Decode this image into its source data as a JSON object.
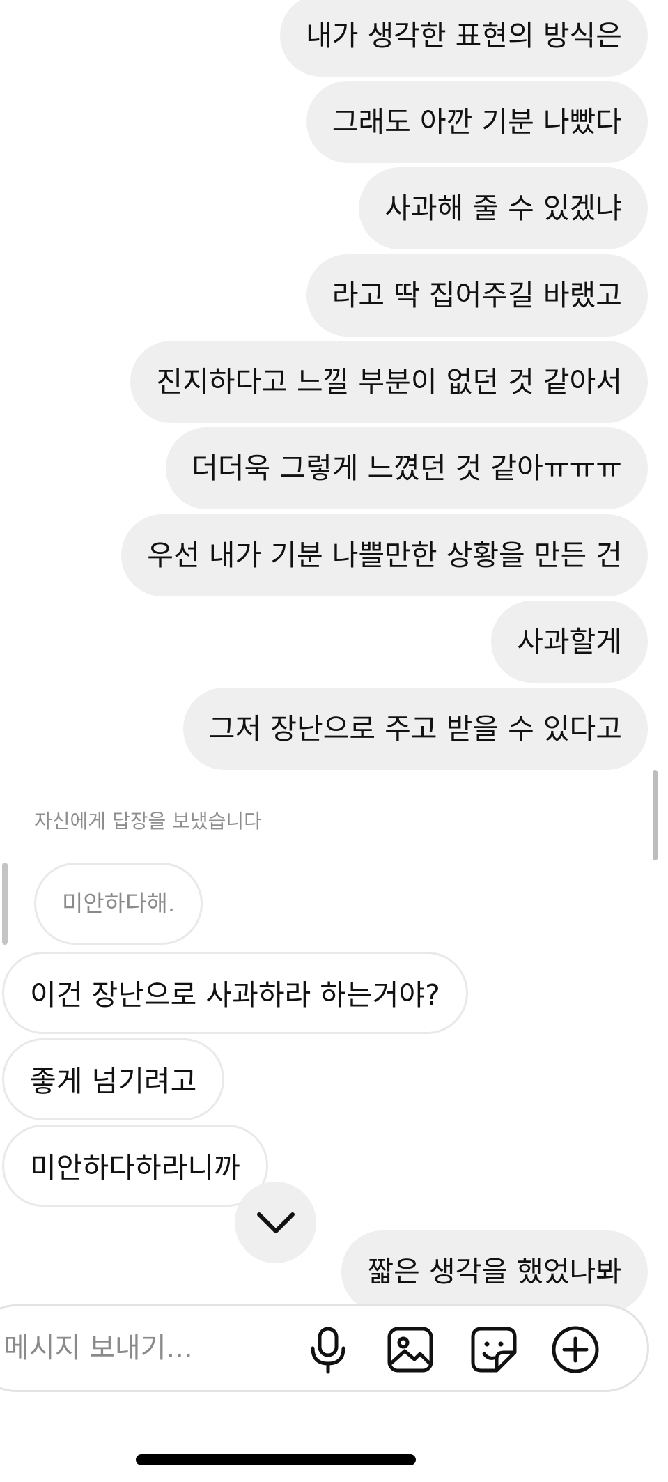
{
  "outgoing_messages": [
    "내가 생각한 표현의 방식은",
    "그래도 아깐 기분 나빴다",
    "사과해 줄 수 있겠냐",
    "라고 딱 집어주길 바랬고",
    "진지하다고 느낄 부분이 없던 것 같아서",
    "더더욱 그렇게 느꼈던 것 같아ㅠㅠㅠ",
    "우선 내가 기분 나쁠만한 상황을 만든 건",
    "사과할게",
    "그저 장난으로 주고 받을 수 있다고"
  ],
  "reply": {
    "label": "자신에게 답장을 보냈습니다",
    "quoted_text": "미안하다해."
  },
  "incoming_messages": [
    "이건 장난으로 사과하라 하는거야?",
    "좋게 넘기려고",
    "미안하다하라니까"
  ],
  "last_outgoing": "짧은 생각을 했었나봐",
  "composer": {
    "placeholder": "메시지 보내기..."
  },
  "icons": {
    "jump": "chevron-down-icon",
    "mic": "microphone-icon",
    "gallery": "image-icon",
    "sticker": "sticker-icon",
    "more": "plus-circle-icon"
  },
  "colors": {
    "outgoing_bubble": "#efefef",
    "incoming_border": "#e9e9e9",
    "muted_text": "#8e8e8e"
  }
}
